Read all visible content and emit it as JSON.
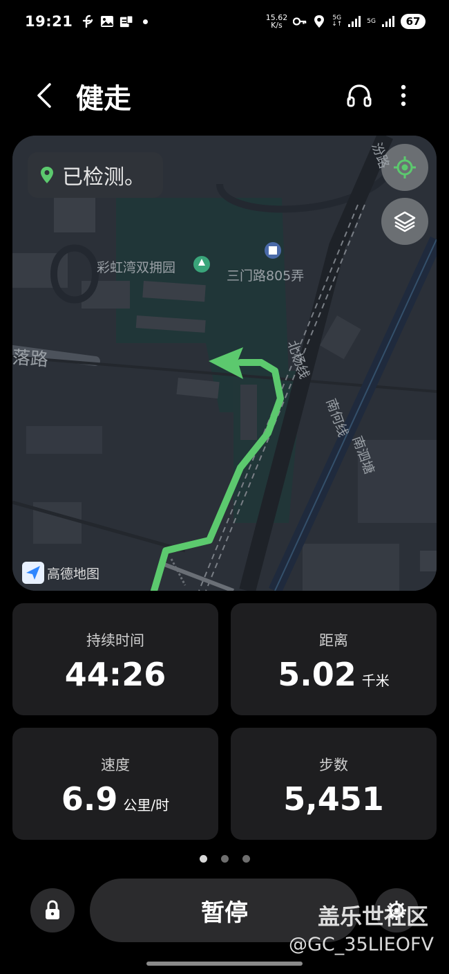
{
  "status_bar": {
    "time": "19:21",
    "net_speed_value": "15.62",
    "net_speed_unit": "K/s",
    "signal_1": "5G",
    "signal_2": "5G",
    "battery": "67"
  },
  "header": {
    "title": "健走"
  },
  "map": {
    "status_text": "已检测。",
    "labels": {
      "park": "彩虹湾双拥园",
      "lane": "三门路805弄",
      "road_left": "落路",
      "rail_1": "北杨线",
      "rail_2": "南何线",
      "road_right": "南泗塘",
      "road_top": "汾路"
    },
    "provider": "高德地图",
    "route_color": "#5cc96e"
  },
  "stats": {
    "duration": {
      "label": "持续时间",
      "value": "44:26",
      "unit": ""
    },
    "distance": {
      "label": "距离",
      "value": "5.02",
      "unit": "千米"
    },
    "speed": {
      "label": "速度",
      "value": "6.9",
      "unit": "公里/时"
    },
    "steps": {
      "label": "步数",
      "value": "5,451",
      "unit": ""
    }
  },
  "pager": {
    "pages": 3,
    "active": 1
  },
  "controls": {
    "pause_label": "暂停"
  },
  "watermark": {
    "title": "盖乐世社区",
    "user": "@GC_35LIEOFV"
  }
}
